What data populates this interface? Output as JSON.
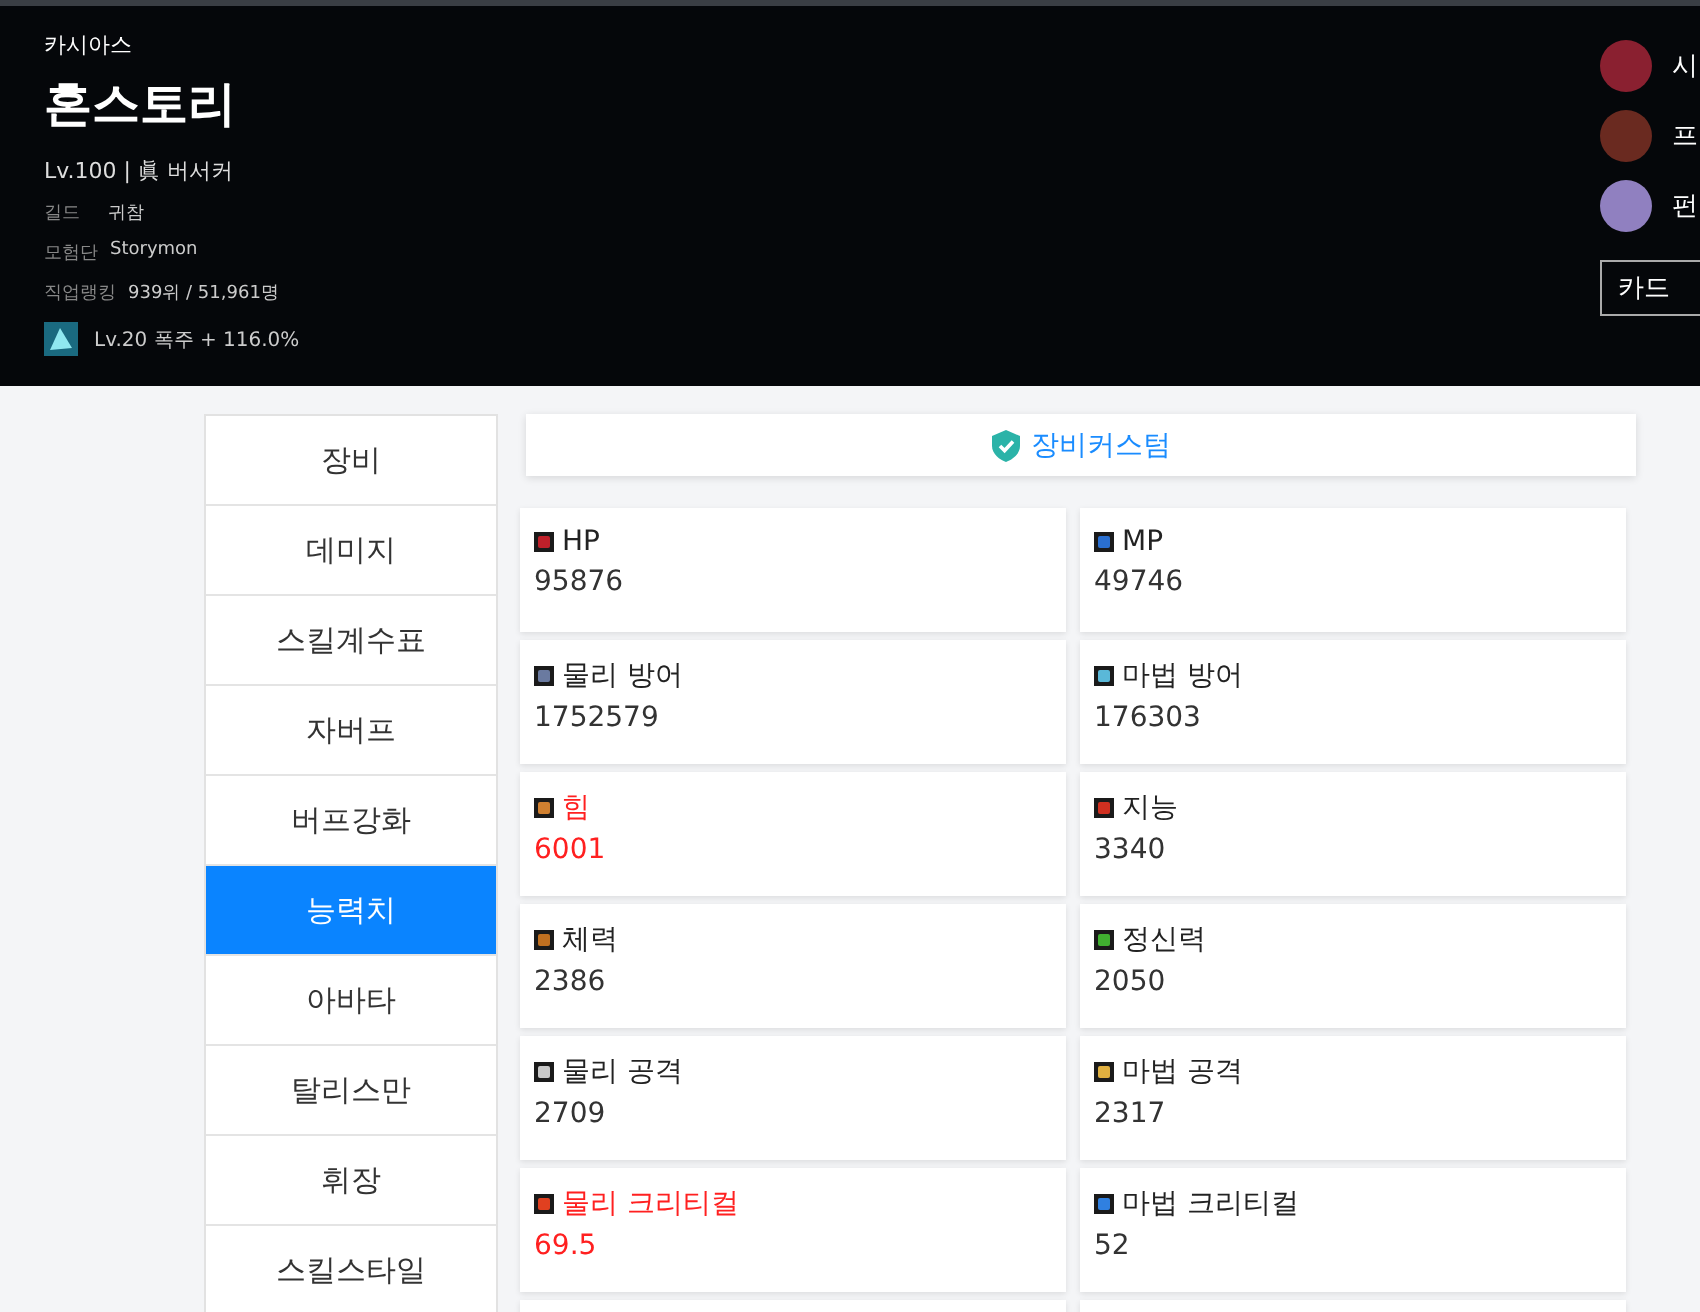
{
  "header": {
    "server": "카시아스",
    "name": "혼스토리",
    "level_job": "Lv.100 | 眞 버서커",
    "guild_label": "길드",
    "guild": "귀참",
    "union_label": "모험단",
    "union": "Storymon",
    "ranking_label": "직업랭킹",
    "ranking": "939위 / 51,961명",
    "buff": "Lv.20 폭주 + 116.0%"
  },
  "side_characters": [
    {
      "name": "시"
    },
    {
      "name": "프"
    },
    {
      "name": "펀"
    }
  ],
  "card_button": "카드",
  "sidebar": {
    "items": [
      {
        "label": "장비",
        "selected": false
      },
      {
        "label": "데미지",
        "selected": false
      },
      {
        "label": "스킬계수표",
        "selected": false
      },
      {
        "label": "자버프",
        "selected": false
      },
      {
        "label": "버프강화",
        "selected": false
      },
      {
        "label": "능력치",
        "selected": true
      },
      {
        "label": "아바타",
        "selected": false
      },
      {
        "label": "탈리스만",
        "selected": false
      },
      {
        "label": "휘장",
        "selected": false
      },
      {
        "label": "스킬스타일",
        "selected": false
      }
    ]
  },
  "custom_bar": {
    "label": "장비커스텀"
  },
  "stats": [
    {
      "label": "HP",
      "value": "95876",
      "highlighted": false,
      "color": "#c0202a"
    },
    {
      "label": "MP",
      "value": "49746",
      "highlighted": false,
      "color": "#2a6fd0"
    },
    {
      "label": "물리 방어",
      "value": "1752579",
      "highlighted": false,
      "color": "#6a7aa0"
    },
    {
      "label": "마법 방어",
      "value": "176303",
      "highlighted": false,
      "color": "#5ab8d8"
    },
    {
      "label": "힘",
      "value": "6001",
      "highlighted": true,
      "color": "#d08030"
    },
    {
      "label": "지능",
      "value": "3340",
      "highlighted": false,
      "color": "#d03020"
    },
    {
      "label": "체력",
      "value": "2386",
      "highlighted": false,
      "color": "#c07020"
    },
    {
      "label": "정신력",
      "value": "2050",
      "highlighted": false,
      "color": "#40b030"
    },
    {
      "label": "물리 공격",
      "value": "2709",
      "highlighted": false,
      "color": "#c8c8c8"
    },
    {
      "label": "마법 공격",
      "value": "2317",
      "highlighted": false,
      "color": "#e0b040"
    },
    {
      "label": "물리 크리티컬",
      "value": "69.5",
      "highlighted": true,
      "color": "#e04020"
    },
    {
      "label": "마법 크리티컬",
      "value": "52",
      "highlighted": false,
      "color": "#3080e0"
    }
  ]
}
